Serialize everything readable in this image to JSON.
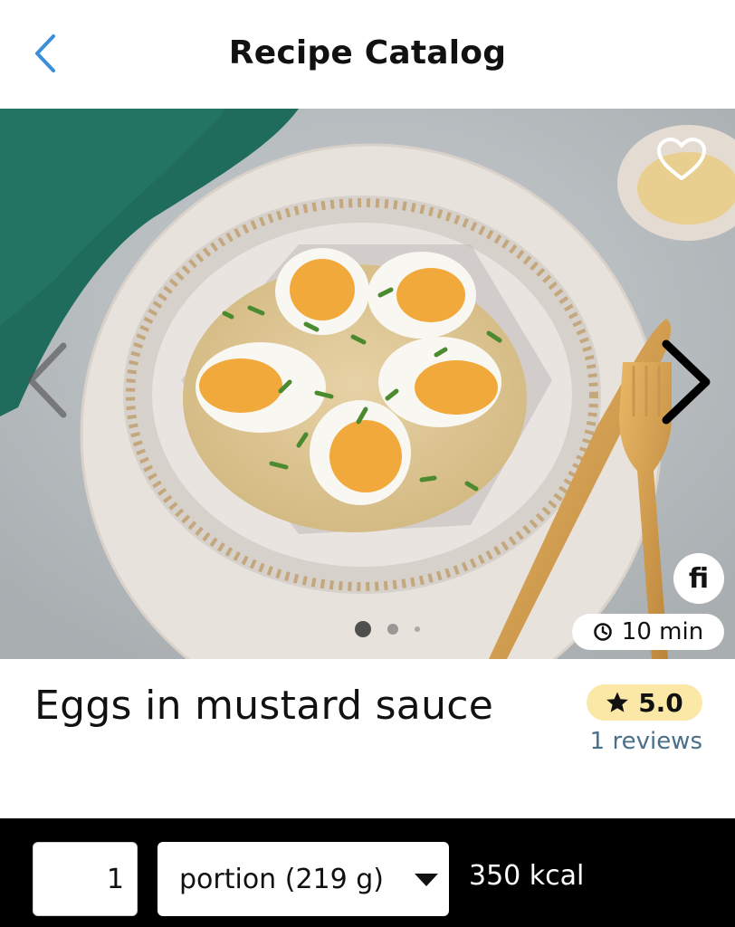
{
  "header": {
    "title": "Recipe Catalog",
    "back_icon": "chevron-left-icon"
  },
  "colors": {
    "accent": "#3b8fd9",
    "rating_bg": "#fbe8a6",
    "reviews_link": "#4a6f8a",
    "bottom_bar": "#000000"
  },
  "hero": {
    "favorite_icon": "heart-outline-icon",
    "prev_icon": "chevron-left-icon",
    "next_icon": "chevron-right-icon",
    "brand_logo_text": "fi",
    "time_icon": "clock-icon",
    "prep_time": "10 min",
    "carousel": {
      "count": 3,
      "active_index": 0
    }
  },
  "recipe": {
    "name": "Eggs in mustard sauce",
    "rating": "5.0",
    "rating_icon": "star-icon",
    "reviews": "1 reviews"
  },
  "bottom_bar": {
    "quantity": "1",
    "unit_selected": "portion (219 g)",
    "kcal": "350 kcal"
  }
}
